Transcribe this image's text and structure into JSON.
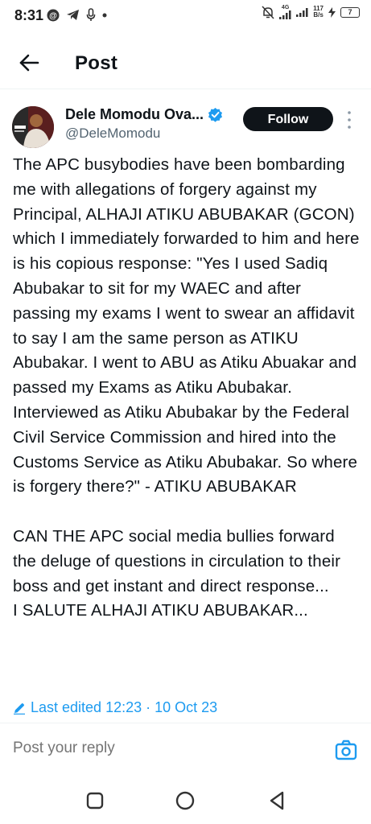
{
  "status_bar": {
    "time": "8:31",
    "network_speed_value": "117",
    "network_speed_unit": "B/s",
    "network_type": "4G",
    "battery_level": "7"
  },
  "header": {
    "title": "Post"
  },
  "author": {
    "name": "Dele Momodu Ova...",
    "handle": "@DeleMomodu",
    "verified": true,
    "follow_label": "Follow"
  },
  "post": {
    "text": "The APC busybodies have been bombarding me with allegations of forgery against my Principal, ALHAJI ATIKU ABUBAKAR (GCON) which I immediately forwarded to him and here is his copious response: \"Yes I used Sadiq Abubakar to sit for my WAEC and after passing my exams I went to swear an affidavit to say I am the same person as ATIKU Abubakar. I went to ABU as Atiku Abuakar and passed my Exams as Atiku Abubakar. Interviewed as Atiku Abubakar by the Federal Civil Service Commission and hired into the Customs Service as Atiku Abubakar. So where is forgery there?\" - ATIKU ABUBAKAR\n\nCAN THE APC social media bullies forward the deluge of questions in circulation to their boss and get instant and direct response...\nI SALUTE ALHAJI ATIKU ABUBAKAR...",
    "last_edited": "Last edited 12:23 · 10 Oct 23"
  },
  "reply": {
    "placeholder": "Post your reply"
  },
  "colors": {
    "accent": "#1d9bf0",
    "text": "#0f1419",
    "secondary": "#536471",
    "follow_bg": "#0f1419"
  },
  "icons": {
    "back": "arrow-left-icon",
    "verified": "verified-badge-icon",
    "more": "more-vertical-icon",
    "edit": "pencil-icon",
    "camera": "camera-icon"
  }
}
